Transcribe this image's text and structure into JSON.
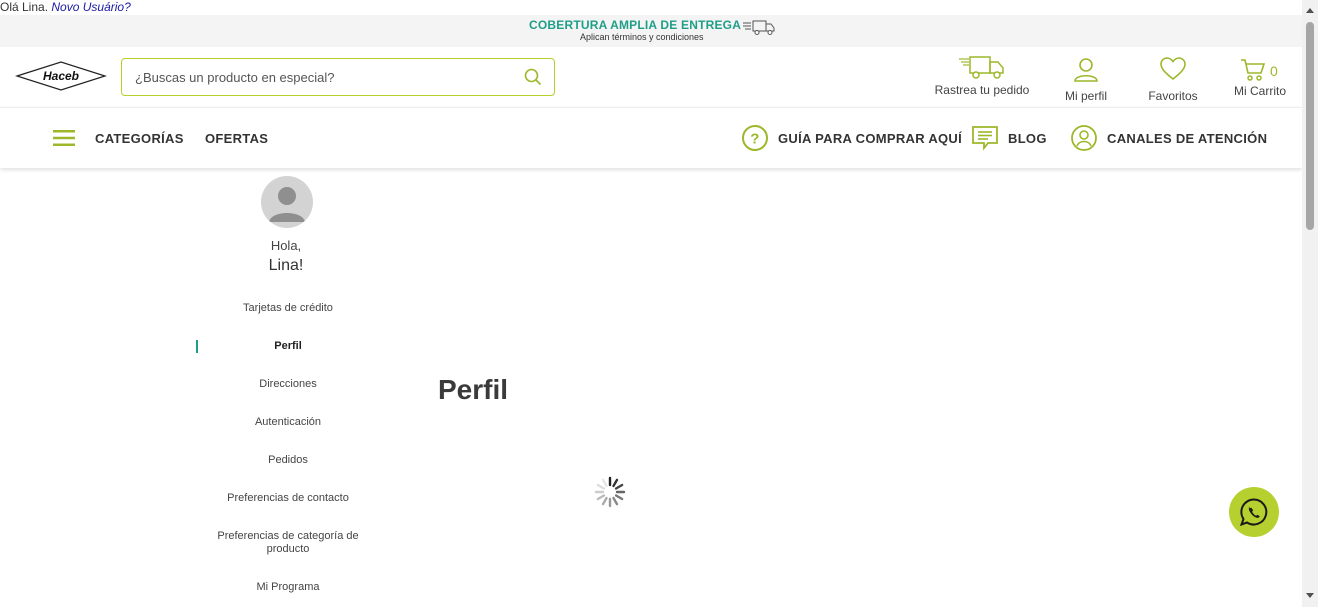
{
  "greeting": {
    "text": "Olá Lina.",
    "new_user_link": "Novo Usuário?"
  },
  "promo": {
    "title": "COBERTURA AMPLIA DE ENTREGA",
    "subtitle": "Aplican términos y condiciones",
    "icon": "delivery-truck-icon"
  },
  "header": {
    "logo_text": "Haceb",
    "search": {
      "placeholder": "¿Buscas un producto en especial?",
      "value": ""
    },
    "actions": {
      "track": "Rastrea tu pedido",
      "profile": "Mi perfil",
      "favorites": "Favoritos",
      "cart": "Mi Carrito",
      "cart_count": "0"
    }
  },
  "nav": {
    "categories": "CATEGORÍAS",
    "offers": "OFERTAS",
    "guide": "GUÍA PARA COMPRAR AQUÍ",
    "blog": "BLOG",
    "channels": "CANALES DE ATENCIÓN"
  },
  "sidebar": {
    "hola": "Hola,",
    "name": "Lina!",
    "items": [
      {
        "label": "Tarjetas de crédito"
      },
      {
        "label": "Perfil",
        "active": true
      },
      {
        "label": "Direcciones"
      },
      {
        "label": "Autenticación"
      },
      {
        "label": "Pedidos"
      },
      {
        "label": "Preferencias de contacto"
      },
      {
        "label": "Preferencias de categoría de producto"
      },
      {
        "label": "Mi Programa"
      }
    ]
  },
  "main": {
    "title": "Perfil"
  },
  "colors": {
    "accent_green": "#b6d12f",
    "teal": "#1f9e87",
    "text_dark": "#333333"
  }
}
